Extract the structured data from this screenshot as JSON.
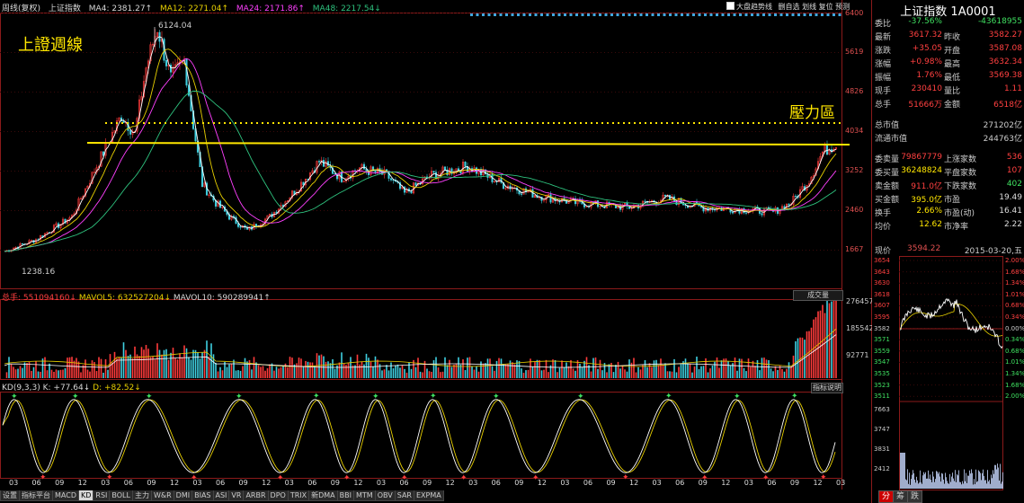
{
  "header": {
    "title": "周线(复权)",
    "name": "上证指数",
    "ma4": "MA4: 2381.27↑",
    "ma12": "MA12: 2271.04↑",
    "ma24": "MA24: 2171.86↑",
    "ma48": "MA48: 2217.54↓"
  },
  "toolbar": {
    "overlay": "大盘趋势线",
    "actions": "删自选 划线 复位 预测"
  },
  "annotations": {
    "title": "上證週線",
    "pressure": "壓力區"
  },
  "price_axis": {
    "ticks": [
      "6400",
      "5619",
      "4826",
      "4034",
      "3252",
      "2460",
      "1667"
    ]
  },
  "peak_label": "6124.04",
  "low_label": "1238.16",
  "volume": {
    "header_a": "总手: 551094160↓",
    "header_b": "MAVOL5: 632527204↓",
    "header_c": "MAVOL10: 590289941↑",
    "button": "成交量",
    "ticks": [
      "276457",
      "185542",
      "92771"
    ]
  },
  "kd": {
    "header_a": "KD(9,3,3) K: +77.64↓",
    "header_b": "D: +82.52↓",
    "button": "指标说明"
  },
  "x_labels": [
    "03",
    "06",
    "09",
    "12",
    "03",
    "06",
    "09",
    "12",
    "03",
    "06",
    "09",
    "12",
    "03",
    "06",
    "09",
    "12",
    "03",
    "06",
    "09",
    "12",
    "03",
    "06",
    "09",
    "12",
    "03",
    "06",
    "09",
    "12",
    "03",
    "06",
    "09",
    "12",
    "03",
    "06",
    "09",
    "12",
    "03"
  ],
  "tabs": [
    "设置",
    "指标平台",
    "MACD",
    "KD",
    "RSI",
    "BOLL",
    "主力",
    "W&R",
    "DMI",
    "BIAS",
    "ASI",
    "VR",
    "ARBR",
    "DPO",
    "TRIX",
    "新DMA",
    "BBI",
    "MTM",
    "OBV",
    "SAR",
    "EXPMA"
  ],
  "active_tab": "KD",
  "quote": {
    "title": "上证指数  1A0001",
    "rows": [
      {
        "l1": "委比",
        "v1": "-37.56%",
        "l2": "",
        "v2": "-43618955"
      },
      {
        "l1": "最新",
        "v1": "3617.32",
        "l2": "昨收",
        "v2": "3582.27"
      },
      {
        "l1": "涨跌",
        "v1": "+35.05",
        "l2": "开盘",
        "v2": "3587.08"
      },
      {
        "l1": "涨幅",
        "v1": "+0.98%",
        "l2": "最高",
        "v2": "3632.34"
      },
      {
        "l1": "振幅",
        "v1": "1.76%",
        "l2": "最低",
        "v2": "3569.38"
      },
      {
        "l1": "现手",
        "v1": "230410",
        "l2": "量比",
        "v2": "1.11"
      },
      {
        "l1": "总手",
        "v1": "51666万",
        "l2": "金额",
        "v2": "6518亿"
      },
      {
        "l1": "总市值",
        "v1": "",
        "l2": "",
        "v2": "271202亿"
      },
      {
        "l1": "流通市值",
        "v1": "",
        "l2": "",
        "v2": "244763亿"
      },
      {
        "l1": "委卖量",
        "v1": "79867779",
        "l2": "上涨家数",
        "v2": "536"
      },
      {
        "l1": "委买量",
        "v1": "36248824",
        "l2": "平盘家数",
        "v2": "107"
      },
      {
        "l1": "卖金额",
        "v1": "911.0亿",
        "l2": "下跌家数",
        "v2": "402"
      },
      {
        "l1": "买金额",
        "v1": "395.0亿",
        "l2": "市盈",
        "v2": "19.49"
      },
      {
        "l1": "换手",
        "v1": "2.66%",
        "l2": "市盈(动)",
        "v2": "16.41"
      },
      {
        "l1": "均价",
        "v1": "12.62",
        "l2": "市净率",
        "v2": "2.22"
      }
    ],
    "current_label": "现价",
    "current_value": "3594.22",
    "current_date": "2015-03-20,五"
  },
  "mini_chart": {
    "left_ticks": [
      "3654",
      "3643",
      "3630",
      "3618",
      "3607",
      "3595",
      "3582",
      "3571",
      "3559",
      "3547",
      "3535",
      "3523",
      "3511"
    ],
    "right_ticks": [
      "2.00%",
      "1.68%",
      "1.34%",
      "1.01%",
      "0.68%",
      "0.34%",
      "0.00%",
      "0.34%",
      "0.68%",
      "1.01%",
      "1.34%",
      "1.68%",
      "2.00%"
    ],
    "vol_ticks": [
      "7663",
      "3747",
      "3831",
      "2412"
    ]
  },
  "right_tabs": [
    "分",
    "筹",
    "跌"
  ],
  "colors": {
    "up": "#ff3b3b",
    "down": "#3fd0e0",
    "ma4": "#ffffff",
    "ma12": "#e8d000",
    "ma24": "#ff40ff",
    "ma48": "#2ec27e",
    "annotation": "#ffe600"
  }
}
